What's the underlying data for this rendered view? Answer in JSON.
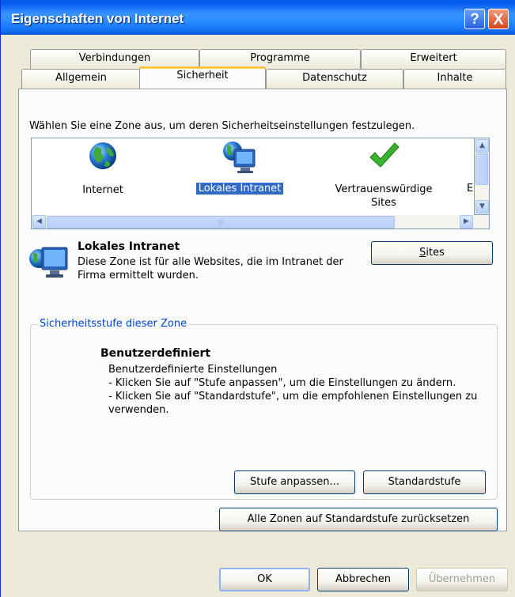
{
  "window": {
    "title": "Eigenschaften von Internet",
    "help": "?",
    "close": "X"
  },
  "tabs_row1": [
    "Verbindungen",
    "Programme",
    "Erweitert"
  ],
  "tabs_row2": [
    "Allgemein",
    "Sicherheit",
    "Datenschutz",
    "Inhalte"
  ],
  "active_tab": "Sicherheit",
  "zone_instruction": "Wählen Sie eine Zone aus, um deren Sicherheitseinstellungen festzulegen.",
  "zones": [
    {
      "label": "Internet",
      "icon": "globe-icon"
    },
    {
      "label": "Lokales Intranet",
      "icon": "computer-globe-icon",
      "selected": true
    },
    {
      "label": "Vertrauenswürdige Sites",
      "icon": "checkmark-icon"
    },
    {
      "label": "E",
      "icon": "restricted-icon"
    }
  ],
  "zone_detail": {
    "name": "Lokales Intranet",
    "description": "Diese Zone ist für alle Websites, die im Intranet der Firma ermittelt wurden.",
    "sites_button": "Sites",
    "sites_button_accel": "S",
    "sites_button_rest": "ites"
  },
  "security_level": {
    "group_title": "Sicherheitsstufe dieser Zone",
    "level_name": "Benutzerdefiniert",
    "level_description": "Benutzerdefinierte Einstellungen\n- Klicken Sie auf \"Stufe anpassen\", um die Einstellungen zu ändern.\n- Klicken Sie auf \"Standardstufe\", um die empfohlenen Einstellungen zu verwenden.",
    "custom_level_button": "Stufe anpassen...",
    "default_level_button": "Standardstufe"
  },
  "reset_all_button": "Alle Zonen auf Standardstufe zurücksetzen",
  "footer": {
    "ok": "OK",
    "cancel": "Abbrechen",
    "apply": "Übernehmen"
  },
  "colors": {
    "titlebar": "#0058ee",
    "selection": "#316ac5",
    "group_title": "#0046d5",
    "tab_highlight": "#ffc73c"
  }
}
